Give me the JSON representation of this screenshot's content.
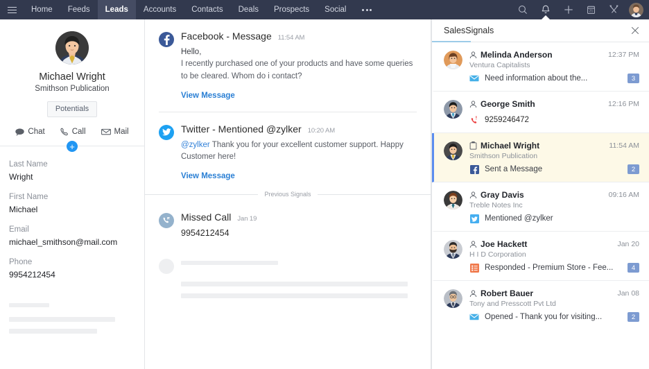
{
  "topnav": {
    "menu_icon": "hamburger-icon",
    "items": [
      {
        "label": "Home",
        "active": false
      },
      {
        "label": "Feeds",
        "active": false
      },
      {
        "label": "Leads",
        "active": true
      },
      {
        "label": "Accounts",
        "active": false
      },
      {
        "label": "Contacts",
        "active": false
      },
      {
        "label": "Deals",
        "active": false
      },
      {
        "label": "Prospects",
        "active": false
      },
      {
        "label": "Social",
        "active": false
      }
    ],
    "more_label": "more-icon",
    "right_icons": [
      {
        "name": "search-icon"
      },
      {
        "name": "bell-icon"
      },
      {
        "name": "plus-icon"
      },
      {
        "name": "calendar-icon"
      },
      {
        "name": "tools-icon"
      }
    ],
    "avatar": "user-avatar"
  },
  "left": {
    "avatar": "lead-avatar",
    "name": "Michael Wright",
    "company": "Smithson Publication",
    "potentials_label": "Potentials",
    "actions": [
      {
        "label": "Chat",
        "icon": "chat-icon"
      },
      {
        "label": "Call",
        "icon": "phone-icon"
      },
      {
        "label": "Mail",
        "icon": "mail-icon"
      }
    ],
    "add_label": "+",
    "fields": [
      {
        "label": "Last Name",
        "value": "Wright"
      },
      {
        "label": "First Name",
        "value": "Michael"
      },
      {
        "label": "Email",
        "value": "michael_smithson@mail.com"
      },
      {
        "label": "Phone",
        "value": "9954212454"
      }
    ]
  },
  "center": {
    "signals": [
      {
        "icon": "facebook-icon",
        "title": "Facebook - Message",
        "time": "11:54 AM",
        "body_bold": "Hello,",
        "body": "I recently purchased one of your products and have some queries to be cleared. Whom do i contact?",
        "link": "View Message"
      },
      {
        "icon": "twitter-icon",
        "title": "Twitter - Mentioned @zylker",
        "time": "10:20 AM",
        "handle": "@zylker",
        "body": "Thank you for your excellent customer support. Happy Customer here!",
        "link": "View Message"
      }
    ],
    "previous_divider_label": "Previous Signals",
    "missed_call": {
      "icon": "missed-call-icon",
      "title": "Missed Call",
      "time": "Jan 19",
      "phone": "9954212454"
    }
  },
  "right": {
    "title": "SalesSignals",
    "close_icon": "close-icon",
    "rows": [
      {
        "avatar": "avatar-melinda",
        "type_icon": "person-icon",
        "name": "Melinda Anderson",
        "org": "Ventura Capitalists",
        "time": "12:37 PM",
        "channel_icon": "mail-icon",
        "message": "Need information about the...",
        "badge": "3",
        "selected": false
      },
      {
        "avatar": "avatar-george",
        "type_icon": "person-icon",
        "name": "George Smith",
        "org": "",
        "time": "12:16 PM",
        "channel_icon": "missed-call-icon",
        "message": "9259246472",
        "badge": "",
        "selected": false
      },
      {
        "avatar": "avatar-michael",
        "type_icon": "lead-icon",
        "name": "Michael Wright",
        "org": "Smithson Publication",
        "time": "11:54 AM",
        "channel_icon": "facebook-icon",
        "message": "Sent a Message",
        "badge": "2",
        "selected": true
      },
      {
        "avatar": "avatar-gray",
        "type_icon": "person-icon",
        "name": "Gray Davis",
        "org": "Treble Notes Inc",
        "time": "09:16 AM",
        "channel_icon": "twitter-icon",
        "message": "Mentioned @zylker",
        "badge": "",
        "selected": false
      },
      {
        "avatar": "avatar-joe",
        "type_icon": "person-icon",
        "name": "Joe Hackett",
        "org": "H I D Corporation",
        "time": "Jan 20",
        "channel_icon": "survey-icon",
        "message": "Responded - Premium Store - Fee...",
        "badge": "4",
        "selected": false
      },
      {
        "avatar": "avatar-robert",
        "type_icon": "person-icon",
        "name": "Robert Bauer",
        "org": "Tony and Presscott Pvt Ltd",
        "time": "Jan 08",
        "channel_icon": "mail-icon",
        "message": "Opened - Thank you for visiting...",
        "badge": "2",
        "selected": false
      }
    ]
  },
  "colors": {
    "nav_bg": "#32394e",
    "nav_active": "#454c63",
    "facebook": "#3b5998",
    "twitter": "#1da1f2",
    "link": "#2a7fd4",
    "selected_row": "#fdf9e7",
    "selected_border": "#5b8def",
    "badge": "#7d9bd1",
    "accent": "#9ccbe8"
  }
}
